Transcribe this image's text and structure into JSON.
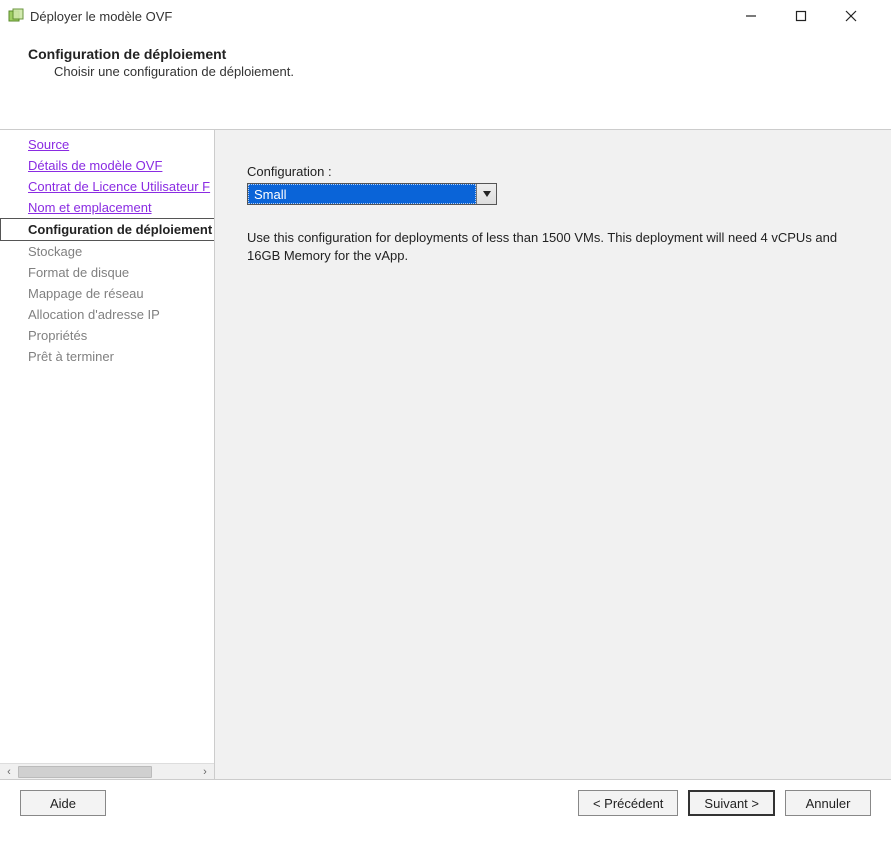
{
  "window": {
    "title": "Déployer le modèle OVF"
  },
  "header": {
    "title": "Configuration de déploiement",
    "subtitle": "Choisir une configuration de déploiement."
  },
  "sidebar": {
    "items": [
      {
        "label": "Source",
        "state": "link"
      },
      {
        "label": "Détails de modèle OVF",
        "state": "link"
      },
      {
        "label": "Contrat de Licence Utilisateur F",
        "state": "link"
      },
      {
        "label": "Nom et emplacement",
        "state": "link"
      },
      {
        "label": "Configuration de déploiement",
        "state": "active"
      },
      {
        "label": "Stockage",
        "state": "disabled"
      },
      {
        "label": "Format de disque",
        "state": "disabled"
      },
      {
        "label": "Mappage de réseau",
        "state": "disabled"
      },
      {
        "label": "Allocation d'adresse IP",
        "state": "disabled"
      },
      {
        "label": "Propriétés",
        "state": "disabled"
      },
      {
        "label": "Prêt à terminer",
        "state": "disabled"
      }
    ]
  },
  "main": {
    "config_label": "Configuration :",
    "config_value": "Small",
    "description": "Use this configuration for deployments of less than 1500 VMs. This deployment will need 4 vCPUs and 16GB Memory for the vApp."
  },
  "footer": {
    "help": "Aide",
    "back": "< Précédent",
    "next": "Suivant >",
    "cancel": "Annuler"
  }
}
